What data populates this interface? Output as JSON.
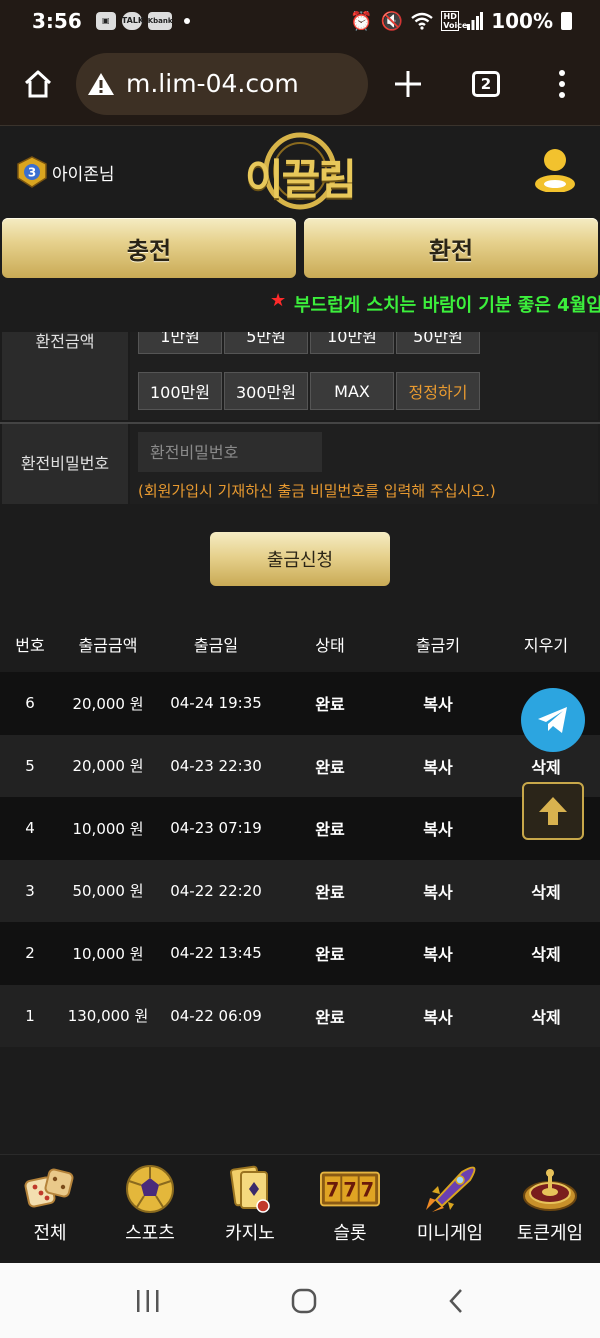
{
  "statusbar": {
    "time": "3:56",
    "notif_talk": "TALK",
    "notif_kbank": "Kbank",
    "hd_label": "HD Voice",
    "battery": "100%"
  },
  "browser": {
    "url": "m.lim-04.com",
    "tab_count": "2"
  },
  "header": {
    "username": "아이존님",
    "level": "3",
    "logo_text": "이끌림"
  },
  "actions": {
    "charge": "충전",
    "exchange": "환전"
  },
  "marquee": {
    "star": "★",
    "message": "부드럽게 스치는 바람이 기분 좋은 4월입"
  },
  "form": {
    "amount_label": "환전금액",
    "amount_buttons_top": [
      "1만원",
      "5만원",
      "10만원",
      "50만원"
    ],
    "amount_buttons_bottom": [
      "100만원",
      "300만원",
      "MAX",
      "정정하기"
    ],
    "password_label": "환전비밀번호",
    "password_placeholder": "환전비밀번호",
    "password_hint": "(회원가입시 기재하신 출금 비밀번호를 입력해 주십시오.)",
    "submit": "출금신청"
  },
  "table": {
    "headers": [
      "번호",
      "출금금액",
      "출금일",
      "상태",
      "출금키",
      "지우기"
    ],
    "rows": [
      {
        "no": "6",
        "amount": "20,000 원",
        "date": "04-24 19:35",
        "status": "완료",
        "key": "복사",
        "delete": ""
      },
      {
        "no": "5",
        "amount": "20,000 원",
        "date": "04-23 22:30",
        "status": "완료",
        "key": "복사",
        "delete": "삭제"
      },
      {
        "no": "4",
        "amount": "10,000 원",
        "date": "04-23 07:19",
        "status": "완료",
        "key": "복사",
        "delete": ""
      },
      {
        "no": "3",
        "amount": "50,000 원",
        "date": "04-22 22:20",
        "status": "완료",
        "key": "복사",
        "delete": "삭제"
      },
      {
        "no": "2",
        "amount": "10,000 원",
        "date": "04-22 13:45",
        "status": "완료",
        "key": "복사",
        "delete": "삭제"
      },
      {
        "no": "1",
        "amount": "130,000 원",
        "date": "04-22 06:09",
        "status": "완료",
        "key": "복사",
        "delete": "삭제"
      }
    ]
  },
  "nav": {
    "items": [
      {
        "label": "전체",
        "icon": "dice-icon"
      },
      {
        "label": "스포츠",
        "icon": "soccer-ball-icon"
      },
      {
        "label": "카지노",
        "icon": "cards-icon"
      },
      {
        "label": "슬롯",
        "icon": "slot-777-icon"
      },
      {
        "label": "미니게임",
        "icon": "rocket-icon"
      },
      {
        "label": "토큰게임",
        "icon": "roulette-icon"
      }
    ],
    "slot_text": "777"
  },
  "colors": {
    "gold": "#e6d18d",
    "hint_orange": "#e89a30",
    "marquee_green": "#3cf03c",
    "telegram_blue": "#2ca5e0"
  }
}
